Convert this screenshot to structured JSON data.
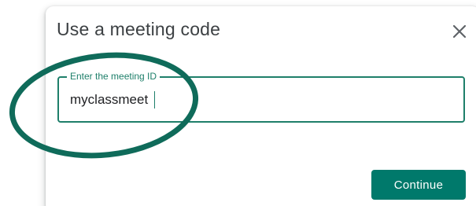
{
  "dialog": {
    "title": "Use a meeting code",
    "close_icon": "close-icon",
    "field": {
      "label": "Enter the meeting ID",
      "value": "myclassmeet"
    },
    "continue_label": "Continue"
  },
  "annotation": {
    "shape": "ellipse",
    "color": "#0f6b5a"
  },
  "colors": {
    "accent": "#1e7f6a",
    "button": "#00796b",
    "title_text": "#3c4043"
  }
}
